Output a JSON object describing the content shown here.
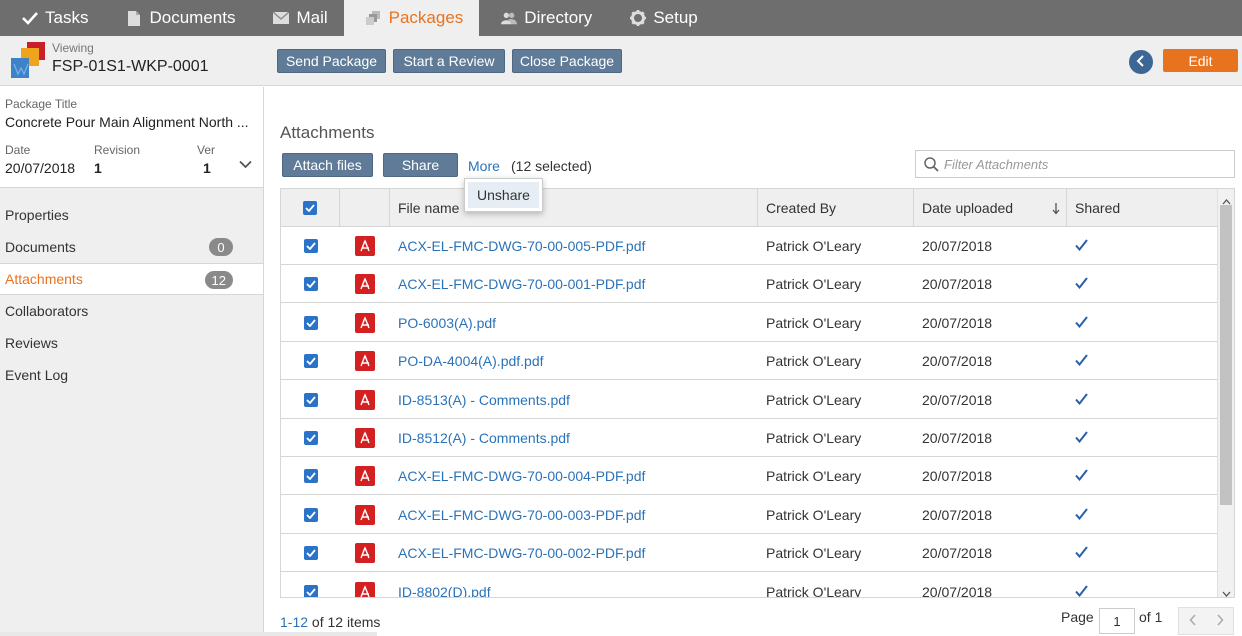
{
  "topnav": {
    "tabs": [
      {
        "label": "Tasks",
        "icon": "check-icon"
      },
      {
        "label": "Documents",
        "icon": "document-icon"
      },
      {
        "label": "Mail",
        "icon": "mail-icon"
      },
      {
        "label": "Packages",
        "icon": "packages-icon",
        "active": true
      },
      {
        "label": "Directory",
        "icon": "people-icon"
      },
      {
        "label": "Setup",
        "icon": "gear-icon"
      }
    ],
    "active_color": "#e8731e"
  },
  "header": {
    "viewing_label": "Viewing",
    "package_id": "FSP-01S1-WKP-0001",
    "actions": {
      "send": "Send Package",
      "review": "Start a Review",
      "close": "Close Package"
    },
    "edit_label": "Edit"
  },
  "sidebar": {
    "title_label": "Package Title",
    "title_value": "Concrete Pour Main Alignment North ...",
    "date_label": "Date",
    "date_value": "20/07/2018",
    "revision_label": "Revision",
    "revision_value": "1",
    "ver_label": "Ver",
    "ver_value": "1",
    "menu": [
      {
        "label": "Properties"
      },
      {
        "label": "Documents",
        "count": "0"
      },
      {
        "label": "Attachments",
        "count": "12",
        "active": true
      },
      {
        "label": "Collaborators"
      },
      {
        "label": "Reviews"
      },
      {
        "label": "Event Log"
      }
    ]
  },
  "attachments": {
    "title": "Attachments",
    "attach_label": "Attach files",
    "share_label": "Share",
    "more_label": "More",
    "selected_text": "(12 selected)",
    "filter_placeholder": "Filter Attachments",
    "dropdown": {
      "unshare": "Unshare"
    },
    "columns": {
      "file_name": "File name",
      "created_by": "Created By",
      "date_uploaded": "Date uploaded",
      "shared": "Shared"
    },
    "rows": [
      {
        "file": "ACX-EL-FMC-DWG-70-00-005-PDF.pdf",
        "by": "Patrick O'Leary",
        "date": "20/07/2018"
      },
      {
        "file": "ACX-EL-FMC-DWG-70-00-001-PDF.pdf",
        "by": "Patrick O'Leary",
        "date": "20/07/2018"
      },
      {
        "file": "PO-6003(A).pdf",
        "by": "Patrick O'Leary",
        "date": "20/07/2018"
      },
      {
        "file": "PO-DA-4004(A).pdf.pdf",
        "by": "Patrick O'Leary",
        "date": "20/07/2018"
      },
      {
        "file": "ID-8513(A) - Comments.pdf",
        "by": "Patrick O'Leary",
        "date": "20/07/2018"
      },
      {
        "file": "ID-8512(A) - Comments.pdf",
        "by": "Patrick O'Leary",
        "date": "20/07/2018"
      },
      {
        "file": "ACX-EL-FMC-DWG-70-00-004-PDF.pdf",
        "by": "Patrick O'Leary",
        "date": "20/07/2018"
      },
      {
        "file": "ACX-EL-FMC-DWG-70-00-003-PDF.pdf",
        "by": "Patrick O'Leary",
        "date": "20/07/2018"
      },
      {
        "file": "ACX-EL-FMC-DWG-70-00-002-PDF.pdf",
        "by": "Patrick O'Leary",
        "date": "20/07/2018"
      },
      {
        "file": "ID-8802(D).pdf",
        "by": "Patrick O'Leary",
        "date": "20/07/2018"
      }
    ],
    "footer": {
      "range": "1-12",
      "of_items": "of 12 items",
      "page_label": "Page",
      "page_value": "1",
      "of_pages": "of 1"
    }
  }
}
